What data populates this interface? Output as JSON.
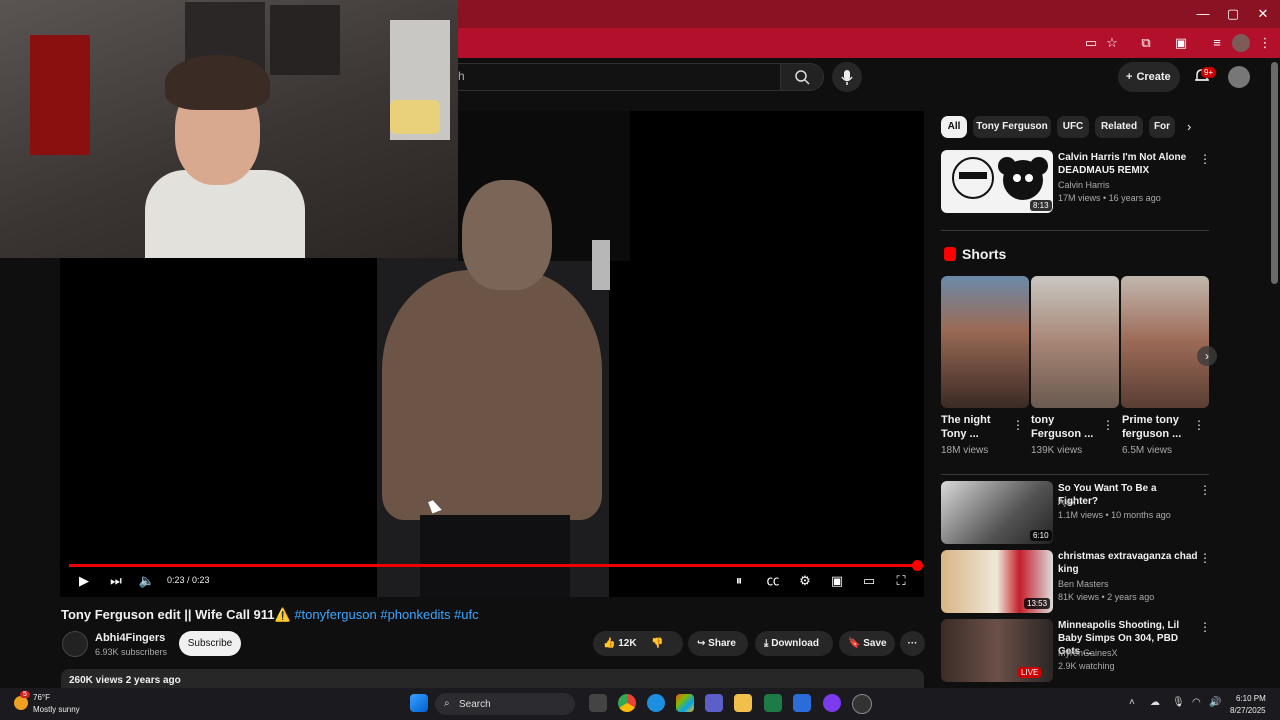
{
  "browser": {
    "title_buttons": {
      "minimize": "—",
      "maximize": "▢",
      "close": "✕"
    }
  },
  "youtube_header": {
    "search_placeholder": "ch",
    "create_label": "Create",
    "notifications_badge": "9+"
  },
  "player": {
    "time_display": "0:23 / 0:23",
    "progress_fraction": 1.0
  },
  "video": {
    "title": "Tony Ferguson edit || Wife Call 911⚠️",
    "hashtags": "#tonyferguson #phonkedits #ufc",
    "channel_name": "Abhi4Fingers",
    "channel_subscribers": "6.93K subscribers",
    "subscribe_label": "Subscribe",
    "like_count": "12K",
    "share_label": "Share",
    "download_label": "Download",
    "save_label": "Save",
    "more_label": "···",
    "views_and_age": "260K views  2 years ago"
  },
  "sidebar": {
    "chips": [
      "All",
      "Tony Ferguson",
      "UFC",
      "Related",
      "For"
    ],
    "top_video": {
      "title": "Calvin Harris I'm Not Alone DEADMAU5 REMIX",
      "channel": "Calvin Harris",
      "meta": "17M views • 16 years ago",
      "duration": "8:13"
    },
    "shorts_heading": "Shorts",
    "shorts": [
      {
        "title": "The night Tony ...",
        "views": "18M views"
      },
      {
        "title": "tony Ferguson ...",
        "views": "139K views"
      },
      {
        "title": "Prime tony ferguson ...",
        "views": "6.5M views"
      }
    ],
    "videos": [
      {
        "title": "So You Want To Be a Fighter?",
        "channel": "Ajax",
        "meta": "1.1M views • 10 months ago",
        "duration": "6:10"
      },
      {
        "title": "christmas extravaganza chad king",
        "channel": "Ben Masters",
        "meta": "81K views • 2 years ago",
        "duration": "13:53"
      },
      {
        "title": "Minneapolis Shooting, Lil Baby Simps On 304, PBD Gets ...",
        "channel": "MyronGainesX",
        "meta": "2.9K watching",
        "duration": "LIVE"
      }
    ]
  },
  "taskbar": {
    "weather_temp": "76°F",
    "weather_desc": "Mostly sunny",
    "weather_alert": "5",
    "search_label": "Search",
    "clock_time": "6:10 PM",
    "clock_date": "8/27/2025"
  },
  "colors": {
    "browser_titlebar": "#8b1222",
    "browser_toolbar": "#b3112b",
    "youtube_red": "#ff0000",
    "hashtag_blue": "#3ea6ff"
  }
}
